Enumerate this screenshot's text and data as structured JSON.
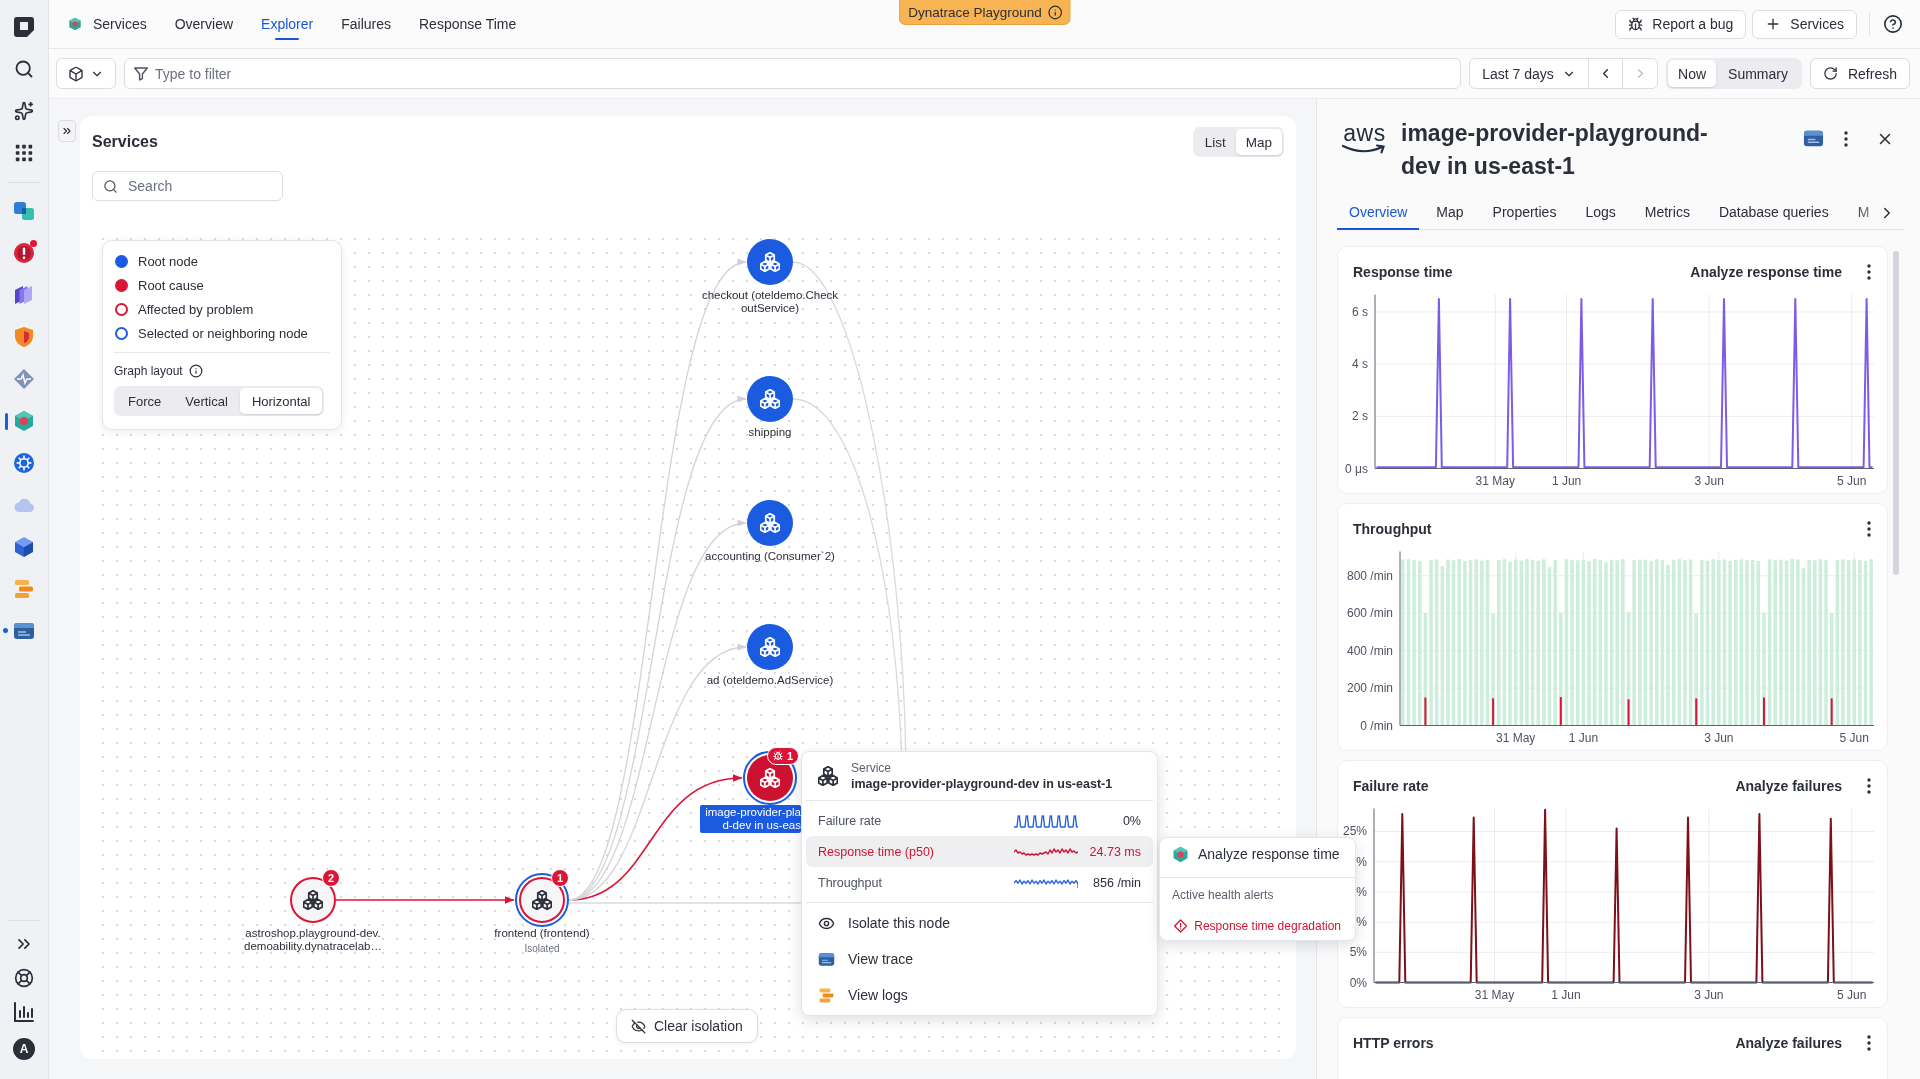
{
  "sidebar": {
    "apps": [
      {
        "selected": false,
        "alert_dot": false,
        "open_dot": false
      },
      {
        "selected": false,
        "alert_dot": true,
        "open_dot": false
      },
      {
        "selected": false,
        "alert_dot": false,
        "open_dot": false
      },
      {
        "selected": false,
        "alert_dot": false,
        "open_dot": false
      },
      {
        "selected": false,
        "alert_dot": false,
        "open_dot": false
      },
      {
        "selected": true,
        "alert_dot": false,
        "open_dot": false
      },
      {
        "selected": false,
        "alert_dot": false,
        "open_dot": false
      },
      {
        "selected": false,
        "alert_dot": false,
        "open_dot": false
      },
      {
        "selected": false,
        "alert_dot": false,
        "open_dot": false
      },
      {
        "selected": false,
        "alert_dot": false,
        "open_dot": false
      },
      {
        "selected": false,
        "alert_dot": false,
        "open_dot": true
      }
    ],
    "user_initial": "A"
  },
  "top_bar": {
    "app_name": "Services",
    "tabs": [
      {
        "label": "Overview",
        "selected": false
      },
      {
        "label": "Explorer",
        "selected": true
      },
      {
        "label": "Failures",
        "selected": false
      },
      {
        "label": "Response Time",
        "selected": false
      }
    ],
    "environment": "Dynatrace Playground",
    "actions": [
      "Report a bug",
      "Services"
    ]
  },
  "filter_bar": {
    "filter": {
      "placeholder": "Type to filter"
    },
    "timeframe": "Last 7 days",
    "previous_disabled": false,
    "next_disabled": true,
    "modes": [
      {
        "label": "Now",
        "selected": true
      },
      {
        "label": "Summary",
        "selected": false
      }
    ],
    "refresh": "Refresh"
  },
  "services_panel": {
    "title": "Services",
    "views": [
      {
        "label": "List",
        "selected": false
      },
      {
        "label": "Map",
        "selected": true
      }
    ],
    "search": {
      "placeholder": "Search"
    },
    "legend": {
      "items": [
        {
          "label": "Root node",
          "kind": "filled",
          "color": "#1a5be0"
        },
        {
          "label": "Root cause",
          "kind": "filled",
          "color": "#dc1435"
        },
        {
          "label": "Affected by problem",
          "kind": "ring",
          "color": "#dc1435"
        },
        {
          "label": "Selected or neighboring node",
          "kind": "ring",
          "color": "#1a5be0"
        }
      ],
      "layout_label": "Graph layout",
      "layouts": [
        {
          "label": "Force",
          "selected": false
        },
        {
          "label": "Vertical",
          "selected": false
        },
        {
          "label": "Horizontal",
          "selected": true
        }
      ]
    },
    "nodes": [
      {
        "label": "checkout (oteldemo.CheckoutService)",
        "kind": "root",
        "selected": false,
        "focused": false
      },
      {
        "label": "shipping",
        "kind": "root",
        "selected": false,
        "focused": false
      },
      {
        "label": "accounting (Consumer`2)",
        "kind": "root",
        "selected": false,
        "focused": false
      },
      {
        "label": "ad (oteldemo.AdService)",
        "kind": "root",
        "selected": false,
        "focused": false
      },
      {
        "label": "image-provider-pla\nd-dev in us-eas",
        "kind": "root_cause",
        "selected": true,
        "focused": true,
        "badge": "1",
        "badge_icon": true
      },
      {
        "label": "astroshop.playground-dev.demoability.dynatracelab…",
        "kind": "affected",
        "selected": false,
        "focused": false,
        "badge": "2",
        "badge_icon": false
      },
      {
        "label": "frontend (frontend)",
        "sublabel": "Isolated",
        "kind": "affected",
        "selected": true,
        "focused": false,
        "badge": "1",
        "badge_icon": false
      }
    ],
    "clear_isolation": "Clear isolation"
  },
  "node_popup": {
    "type_label": "Service",
    "title": "image-provider-playground-dev in us-east-1",
    "metrics": [
      {
        "label": "Failure rate",
        "kind": "spikes",
        "value": "0%",
        "selected": false,
        "alert": false
      },
      {
        "label": "Response time (p50)",
        "kind": "jagged",
        "value": "24.73 ms",
        "selected": true,
        "alert": true
      },
      {
        "label": "Throughput",
        "kind": "wave",
        "value": "856 /min",
        "selected": false,
        "alert": false
      }
    ],
    "actions": [
      "Isolate this node",
      "View trace",
      "View logs"
    ]
  },
  "metric_menu": {
    "action": "Analyze response time",
    "alerts_heading": "Active health alerts",
    "alerts": [
      "Response time degradation"
    ]
  },
  "details": {
    "logo_text": "aws",
    "title": "image-provider-playground-dev in us-east-1",
    "tabs": [
      {
        "label": "Overview",
        "selected": true
      },
      {
        "label": "Map",
        "selected": false
      },
      {
        "label": "Properties",
        "selected": false
      },
      {
        "label": "Logs",
        "selected": false
      },
      {
        "label": "Metrics",
        "selected": false
      },
      {
        "label": "Database queries",
        "selected": false
      },
      {
        "label": "M",
        "selected": false
      }
    ],
    "cards": [
      {
        "title": "Response time",
        "action": "Analyze response time",
        "chart_data": {
          "type": "line",
          "grid": true,
          "categories": [
            null,
            null,
            null,
            null,
            null,
            null,
            null,
            null,
            null,
            null,
            null,
            null,
            null,
            null,
            null,
            null,
            null,
            null,
            null,
            null,
            null,
            null,
            null,
            null,
            null,
            null,
            null,
            null,
            null,
            null,
            null,
            null,
            null,
            null,
            null,
            null,
            null,
            null,
            null,
            null,
            "31 May",
            null,
            null,
            null,
            null,
            null,
            null,
            null,
            null,
            null,
            null,
            null,
            null,
            null,
            null,
            null,
            null,
            null,
            null,
            null,
            null,
            null,
            null,
            null,
            "1 Jun",
            null,
            null,
            null,
            null,
            null,
            null,
            null,
            null,
            null,
            null,
            null,
            null,
            null,
            null,
            null,
            null,
            null,
            null,
            null,
            null,
            null,
            null,
            null,
            null,
            null,
            null,
            null,
            null,
            null,
            null,
            null,
            null,
            null,
            null,
            null,
            null,
            null,
            null,
            null,
            null,
            null,
            null,
            null,
            null,
            null,
            null,
            null,
            "3 Jun",
            null,
            null,
            null,
            null,
            null,
            null,
            null,
            null,
            null,
            null,
            null,
            null,
            null,
            null,
            null,
            null,
            null,
            null,
            null,
            null,
            null,
            null,
            null,
            null,
            null,
            null,
            null,
            null,
            null,
            null,
            null,
            null,
            null,
            null,
            null,
            null,
            null,
            null,
            null,
            null,
            null,
            null,
            null,
            null,
            null,
            null,
            null,
            "5 Jun",
            null,
            null,
            null,
            null,
            null,
            null,
            null
          ],
          "series": [
            {
              "color": "#7c5ce6",
              "values": [
                0.05,
                0.05,
                0.05,
                0.05,
                0.05,
                0.05,
                0.05,
                0.05,
                0.05,
                0.05,
                0.05,
                0.05,
                0.05,
                0.05,
                0.05,
                0.05,
                0.05,
                0.05,
                0.05,
                0.05,
                0.05,
                6.5,
                0.05,
                0.05,
                0.05,
                0.05,
                0.05,
                0.05,
                0.05,
                0.05,
                0.05,
                0.05,
                0.05,
                0.05,
                0.05,
                0.05,
                0.05,
                0.05,
                0.05,
                0.05,
                0.05,
                0.05,
                0.05,
                0.05,
                0.05,
                6.5,
                0.05,
                0.05,
                0.05,
                0.05,
                0.05,
                0.05,
                0.05,
                0.05,
                0.05,
                0.05,
                0.05,
                0.05,
                0.05,
                0.05,
                0.05,
                0.05,
                0.05,
                0.05,
                0.05,
                0.05,
                0.05,
                0.05,
                0.05,
                6.5,
                0.05,
                0.05,
                0.05,
                0.05,
                0.05,
                0.05,
                0.05,
                0.05,
                0.05,
                0.05,
                0.05,
                0.05,
                0.05,
                0.05,
                0.05,
                0.05,
                0.05,
                0.05,
                0.05,
                0.05,
                0.05,
                0.05,
                0.05,
                6.5,
                0.05,
                0.05,
                0.05,
                0.05,
                0.05,
                0.05,
                0.05,
                0.05,
                0.05,
                0.05,
                0.05,
                0.05,
                0.05,
                0.05,
                0.05,
                0.05,
                0.05,
                0.05,
                0.05,
                0.05,
                0.05,
                0.05,
                0.05,
                6.5,
                0.05,
                0.05,
                0.05,
                0.05,
                0.05,
                0.05,
                0.05,
                0.05,
                0.05,
                0.05,
                0.05,
                0.05,
                0.05,
                0.05,
                0.05,
                0.05,
                0.05,
                0.05,
                0.05,
                0.05,
                0.05,
                0.05,
                0.05,
                6.5,
                0.05,
                0.05,
                0.05,
                0.05,
                0.05,
                0.05,
                0.05,
                0.05,
                0.05,
                0.05,
                0.05,
                0.05,
                0.05,
                0.05,
                0.05,
                0.05,
                0.05,
                0.05,
                0.05,
                0.05,
                0.05,
                0.05,
                0.05,
                6.5,
                0.05,
                0.05
              ]
            }
          ],
          "ylim": [
            0,
            6.67
          ],
          "yticks": [
            {
              "value": 0,
              "label": "0 μs"
            },
            {
              "value": 2,
              "label": "2 s"
            },
            {
              "value": 4,
              "label": "4 s"
            },
            {
              "value": 6,
              "label": "6 s"
            }
          ]
        }
      },
      {
        "title": "Throughput",
        "chart_data": {
          "type": "bar",
          "grid": true,
          "categories": [
            null,
            null,
            null,
            null,
            null,
            null,
            null,
            null,
            null,
            null,
            null,
            null,
            null,
            null,
            null,
            null,
            null,
            null,
            null,
            null,
            "31 May",
            null,
            null,
            null,
            null,
            null,
            null,
            null,
            null,
            null,
            null,
            null,
            "1 Jun",
            null,
            null,
            null,
            null,
            null,
            null,
            null,
            null,
            null,
            null,
            null,
            null,
            null,
            null,
            null,
            null,
            null,
            null,
            null,
            null,
            null,
            null,
            null,
            "3 Jun",
            null,
            null,
            null,
            null,
            null,
            null,
            null,
            null,
            null,
            null,
            null,
            null,
            null,
            null,
            null,
            null,
            null,
            null,
            null,
            null,
            null,
            null,
            null,
            "5 Jun",
            null,
            null,
            null
          ],
          "series": [
            {
              "color": "#cdeedc",
              "values": [
                886,
                889,
                884,
                880,
                602,
                885,
                888,
                852,
                887,
                883,
                890,
                879,
                884,
                888,
                881,
                886,
                598,
                884,
                889,
                876,
                887,
                882,
                890,
                885,
                881,
                888,
                846,
                884,
                604,
                889,
                885,
                883,
                887,
                880,
                890,
                884,
                872,
                886,
                883,
                889,
                606,
                884,
                887,
                885,
                880,
                889,
                884,
                858,
                886,
                890,
                883,
                887,
                600,
                885,
                881,
                889,
                884,
                887,
                880,
                886,
                889,
                883,
                885,
                879,
                603,
                888,
                884,
                886,
                881,
                890,
                887,
                842,
                885,
                883,
                889,
                886,
                601,
                884,
                888,
                883,
                887,
                885,
                880,
                889
              ]
            },
            {
              "color": "#dc1435",
              "values": [
                0,
                0,
                0,
                0,
                150,
                0,
                0,
                0,
                0,
                0,
                0,
                0,
                0,
                0,
                0,
                0,
                145,
                0,
                0,
                0,
                0,
                0,
                0,
                0,
                0,
                0,
                0,
                0,
                152,
                0,
                0,
                0,
                0,
                0,
                0,
                0,
                0,
                0,
                0,
                0,
                140,
                0,
                0,
                0,
                0,
                0,
                0,
                0,
                0,
                0,
                0,
                0,
                145,
                0,
                0,
                0,
                0,
                0,
                0,
                0,
                0,
                0,
                0,
                0,
                150,
                0,
                0,
                0,
                0,
                0,
                0,
                0,
                0,
                0,
                0,
                0,
                145,
                0,
                0,
                0,
                0,
                0,
                0,
                0
              ]
            }
          ],
          "ylim": [
            0,
            930
          ],
          "yticks": [
            {
              "value": 0,
              "label": "0 /min"
            },
            {
              "value": 200,
              "label": "200 /min"
            },
            {
              "value": 400,
              "label": "400 /min"
            },
            {
              "value": 600,
              "label": "600 /min"
            },
            {
              "value": 800,
              "label": "800 /min"
            }
          ]
        }
      },
      {
        "title": "Failure rate",
        "action": "Analyze failures",
        "chart_data": {
          "type": "line",
          "grid": true,
          "categories": [
            null,
            null,
            null,
            null,
            null,
            null,
            null,
            null,
            null,
            null,
            null,
            null,
            null,
            null,
            null,
            null,
            null,
            null,
            null,
            null,
            null,
            null,
            null,
            null,
            null,
            null,
            null,
            null,
            null,
            null,
            null,
            null,
            null,
            null,
            null,
            null,
            null,
            null,
            null,
            null,
            "31 May",
            null,
            null,
            null,
            null,
            null,
            null,
            null,
            null,
            null,
            null,
            null,
            null,
            null,
            null,
            null,
            null,
            null,
            null,
            null,
            null,
            null,
            null,
            null,
            "1 Jun",
            null,
            null,
            null,
            null,
            null,
            null,
            null,
            null,
            null,
            null,
            null,
            null,
            null,
            null,
            null,
            null,
            null,
            null,
            null,
            null,
            null,
            null,
            null,
            null,
            null,
            null,
            null,
            null,
            null,
            null,
            null,
            null,
            null,
            null,
            null,
            null,
            null,
            null,
            null,
            null,
            null,
            null,
            null,
            null,
            null,
            null,
            null,
            "3 Jun",
            null,
            null,
            null,
            null,
            null,
            null,
            null,
            null,
            null,
            null,
            null,
            null,
            null,
            null,
            null,
            null,
            null,
            null,
            null,
            null,
            null,
            null,
            null,
            null,
            null,
            null,
            null,
            null,
            null,
            null,
            null,
            null,
            null,
            null,
            null,
            null,
            null,
            null,
            null,
            null,
            null,
            null,
            null,
            null,
            null,
            null,
            null,
            "5 Jun",
            null,
            null,
            null,
            null,
            null,
            null,
            null
          ],
          "series": [
            {
              "color": "#7e1018",
              "values": [
                0,
                0,
                0,
                0,
                0,
                0,
                0,
                0,
                0,
                27.9,
                0,
                0,
                0,
                0,
                0,
                0,
                0,
                0,
                0,
                0,
                0,
                0,
                0,
                0,
                0,
                0,
                0,
                0,
                0,
                0,
                0,
                0,
                0,
                27.3,
                0,
                0,
                0,
                0,
                0,
                0,
                0,
                0,
                0,
                0,
                0,
                0,
                0,
                0,
                0,
                0,
                0,
                0,
                0,
                0,
                0,
                0,
                0,
                28.6,
                0,
                0,
                0,
                0,
                0,
                0,
                0,
                0,
                0,
                0,
                0,
                0,
                0,
                0,
                0,
                0,
                0,
                0,
                0,
                0,
                0,
                0,
                0,
                25.5,
                0,
                0,
                0,
                0,
                0,
                0,
                0,
                0,
                0,
                0,
                0,
                0,
                0,
                0,
                0,
                0,
                0,
                0,
                0,
                0,
                0,
                0,
                0,
                27.3,
                0,
                0,
                0,
                0,
                0,
                0,
                0,
                0,
                0,
                0,
                0,
                0,
                0,
                0,
                0,
                0,
                0,
                0,
                0,
                0,
                0,
                0,
                0,
                27.9,
                0,
                0,
                0,
                0,
                0,
                0,
                0,
                0,
                0,
                0,
                0,
                0,
                0,
                0,
                0,
                0,
                0,
                0,
                0,
                0,
                0,
                0,
                0,
                27.1,
                0,
                0,
                0,
                0,
                0,
                0,
                0,
                0,
                0,
                0,
                0,
                0,
                0,
                0
              ]
            }
          ],
          "ylim": [
            0,
            28.8
          ],
          "yticks": [
            {
              "value": 0,
              "label": "0%"
            },
            {
              "value": 5,
              "label": "5%"
            },
            {
              "value": 10,
              "label": "%"
            },
            {
              "value": 15,
              "label": "%"
            },
            {
              "value": 20,
              "label": "%"
            },
            {
              "value": 25,
              "label": "25%"
            }
          ]
        }
      },
      {
        "title": "HTTP errors",
        "action": "Analyze failures"
      }
    ]
  }
}
